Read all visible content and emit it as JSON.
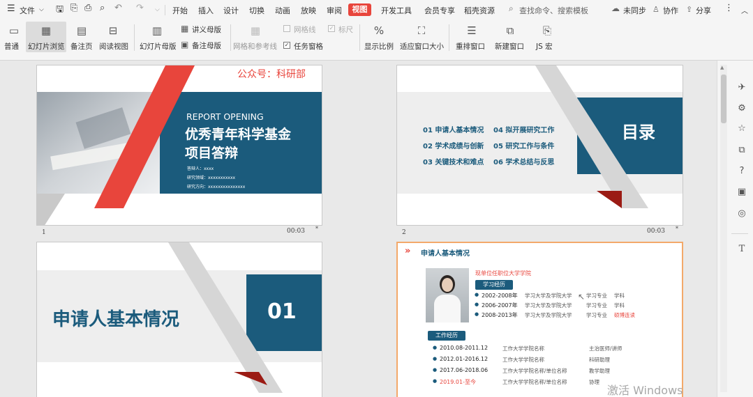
{
  "menu": {
    "file": "文件",
    "tabs": [
      "开始",
      "插入",
      "设计",
      "切换",
      "动画",
      "放映",
      "审阅",
      "视图",
      "开发工具",
      "会员专享",
      "稻壳资源"
    ],
    "active_tab": "视图",
    "search": "查找命令、搜索模板",
    "sync": "未同步",
    "collab": "协作",
    "share": "分享"
  },
  "ribbon": {
    "normal": "普通",
    "sorter": "幻灯片浏览",
    "notes_page": "备注页",
    "reading": "阅读视图",
    "slide_master": "幻灯片母版",
    "handout_master": "讲义母版",
    "notes_master": "备注母版",
    "grid_guides": "网格和参考线",
    "gridlines": "网格线",
    "ruler": "标尺",
    "task_pane": "任务窗格",
    "zoom": "显示比例",
    "fit": "适应窗口大小",
    "arrange": "重排窗口",
    "new_window": "新建窗口",
    "macro": "JS 宏"
  },
  "slides": [
    {
      "number": "1",
      "time": "00:03",
      "watermark": "公众号：科研部",
      "subtitle": "REPORT OPENING",
      "title_line1": "优秀青年科学基金",
      "title_line2": "项目答辩",
      "info": [
        "答辩人：xxxx",
        "研究领域：xxxxxxxxxxx",
        "研究方向：xxxxxxxxxxxxxxx"
      ]
    },
    {
      "number": "2",
      "time": "00:03",
      "heading": "目录",
      "items": [
        "01 申请人基本情况",
        "02 学术成绩与创新",
        "03 关键技术和难点",
        "04 拟开展研究工作",
        "05 研究工作与条件",
        "06 学术总结与反思"
      ]
    },
    {
      "title": "申请人基本情况",
      "num": "01"
    },
    {
      "header": "申请人基本情况",
      "affiliation": "现单位任职位大学学院",
      "edu_label": "学习经历",
      "edu": [
        {
          "period": "2002-2008年",
          "school": "学习大学及学院大学",
          "major": "学习专业",
          "degree": "学科"
        },
        {
          "period": "2006-2007年",
          "school": "学习大学及学院大学",
          "major": "学习专业",
          "degree": "学科"
        },
        {
          "period": "2008-2013年",
          "school": "学习大学及学院大学",
          "major": "学习专业",
          "degree": "硕博连读"
        }
      ],
      "work_label": "工作经历",
      "work": [
        {
          "period": "2010.08-2011.12",
          "place": "工作大学学院名称",
          "role": "主治医师/讲师"
        },
        {
          "period": "2012.01-2016.12",
          "place": "工作大学学院名称",
          "role": "科研助理"
        },
        {
          "period": "2017.06-2018.06",
          "place": "工作大学学院名称/单位名称",
          "role": "教学助理"
        },
        {
          "period": "2019.01-至今",
          "place": "工作大学学院名称/单位名称",
          "role": "协理"
        }
      ]
    }
  ],
  "activation": "激活 Windows",
  "colors": {
    "accent": "#e8453c",
    "navy": "#1b5b7c",
    "active_tab": "#e8453c",
    "ribbon_bg": "#f5f5f5"
  }
}
